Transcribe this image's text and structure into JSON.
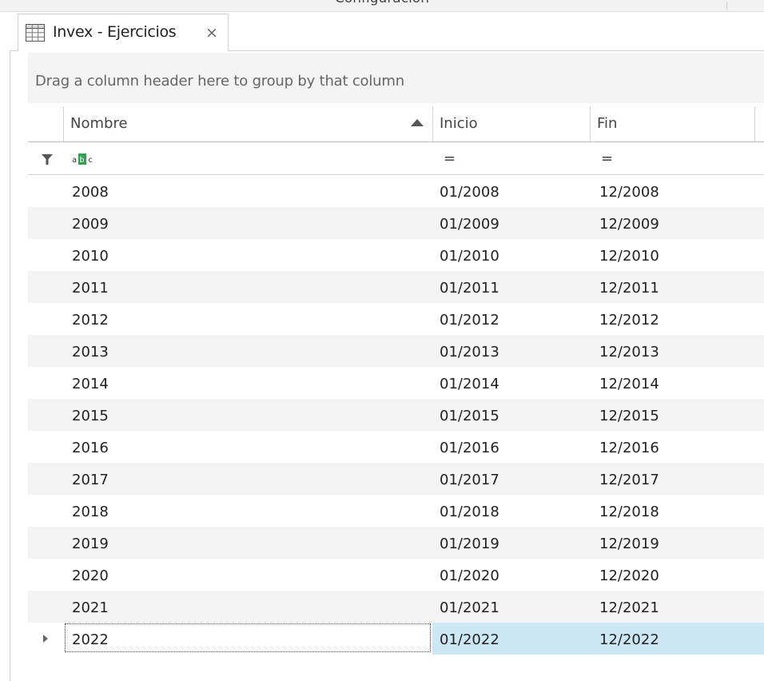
{
  "window": {
    "title": "Configuración"
  },
  "tab": {
    "label": "Invex - Ejercicios",
    "close_glyph": "×",
    "icon": "grid-icon"
  },
  "group_panel": {
    "hint": "Drag a column header here to group by that column"
  },
  "columns": [
    {
      "label": "Nombre",
      "sort": "ascending"
    },
    {
      "label": "Inicio"
    },
    {
      "label": "Fin"
    }
  ],
  "filter_row": {
    "nombre_icon": "abc-filter-icon",
    "inicio_op": "=",
    "fin_op": "="
  },
  "colors": {
    "selection": "#cde8f5",
    "alt_row": "#f4f4f4",
    "abc_green": "#2e9e4f"
  },
  "rows": [
    {
      "nombre": "2008",
      "inicio": "01/2008",
      "fin": "12/2008"
    },
    {
      "nombre": "2009",
      "inicio": "01/2009",
      "fin": "12/2009"
    },
    {
      "nombre": "2010",
      "inicio": "01/2010",
      "fin": "12/2010"
    },
    {
      "nombre": "2011",
      "inicio": "01/2011",
      "fin": "12/2011"
    },
    {
      "nombre": "2012",
      "inicio": "01/2012",
      "fin": "12/2012"
    },
    {
      "nombre": "2013",
      "inicio": "01/2013",
      "fin": "12/2013"
    },
    {
      "nombre": "2014",
      "inicio": "01/2014",
      "fin": "12/2014"
    },
    {
      "nombre": "2015",
      "inicio": "01/2015",
      "fin": "12/2015"
    },
    {
      "nombre": "2016",
      "inicio": "01/2016",
      "fin": "12/2016"
    },
    {
      "nombre": "2017",
      "inicio": "01/2017",
      "fin": "12/2017"
    },
    {
      "nombre": "2018",
      "inicio": "01/2018",
      "fin": "12/2018"
    },
    {
      "nombre": "2019",
      "inicio": "01/2019",
      "fin": "12/2019"
    },
    {
      "nombre": "2020",
      "inicio": "01/2020",
      "fin": "12/2020"
    },
    {
      "nombre": "2021",
      "inicio": "01/2021",
      "fin": "12/2021"
    },
    {
      "nombre": "2022",
      "inicio": "01/2022",
      "fin": "12/2022",
      "selected": true
    }
  ]
}
